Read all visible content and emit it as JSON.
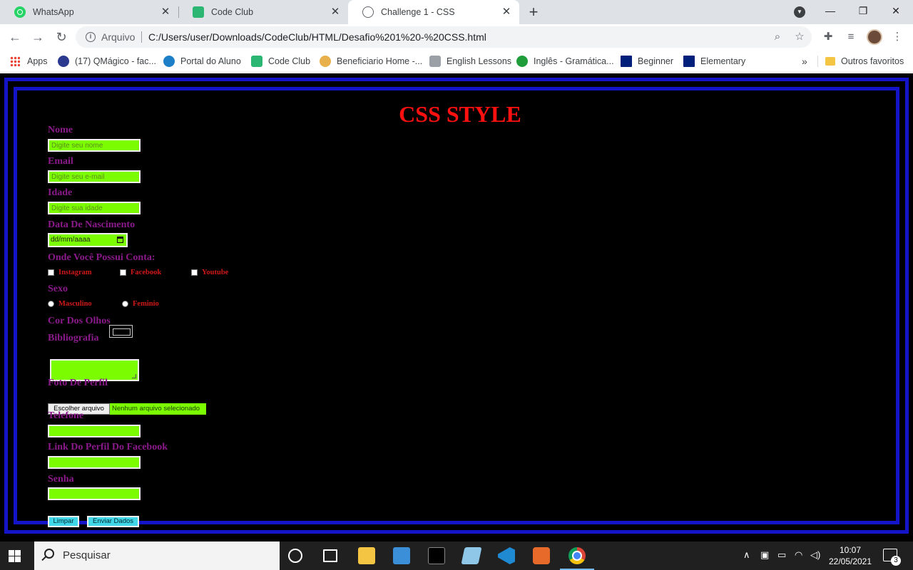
{
  "browser": {
    "tabs": [
      {
        "title": "WhatsApp",
        "icon": "whatsapp-icon"
      },
      {
        "title": "Code Club",
        "icon": "code-club-icon"
      },
      {
        "title": "Challenge 1 - CSS",
        "icon": "globe-icon",
        "active": true
      }
    ],
    "omnibox": {
      "label": "Arquivo",
      "url": "C:/Users/user/Downloads/CodeClub/HTML/Desafio%201%20-%20CSS.html"
    },
    "bookmarks": [
      {
        "label": "Apps",
        "icon": "apps-grid-icon"
      },
      {
        "label": "(17) QMágico - fac...",
        "icon": "qmagico-icon"
      },
      {
        "label": "Portal do Aluno",
        "icon": "portal-icon"
      },
      {
        "label": "Code Club",
        "icon": "code-club-icon"
      },
      {
        "label": "Beneficiario Home -...",
        "icon": "beneficiario-icon"
      },
      {
        "label": "English Lessons",
        "icon": "english-lessons-icon"
      },
      {
        "label": "Inglês - Gramática...",
        "icon": "brazil-flag-icon"
      },
      {
        "label": "Beginner",
        "icon": "oup-icon"
      },
      {
        "label": "Elementary",
        "icon": "oup-icon"
      }
    ],
    "bookmarks_more": "»",
    "other_bookmarks": "Outros favoritos"
  },
  "page": {
    "title": "CSS STYLE",
    "fields": {
      "nome": {
        "label": "Nome",
        "placeholder": "Digite seu nome"
      },
      "email": {
        "label": "Email",
        "placeholder": "Digite seu e-mail"
      },
      "idade": {
        "label": "Idade",
        "placeholder": "Digite sua idade"
      },
      "nascimento": {
        "label": "Data De Nascimento",
        "value": "dd/mm/aaaa"
      },
      "contas": {
        "label": "Onde Você Possui Conta:",
        "options": [
          "Instagram",
          "Facebook",
          "Youtube"
        ]
      },
      "sexo": {
        "label": "Sexo",
        "options": [
          "Masculino",
          "Feminio"
        ]
      },
      "olhos": {
        "label": "Cor Dos Olhos"
      },
      "bibliografia": {
        "label": "Bibliografia"
      },
      "foto": {
        "label": "Foto De Perfil",
        "button": "Escolher arquivo",
        "status": "Nenhum arquivo selecionado"
      },
      "telefone": {
        "label": "Telefone"
      },
      "facebook": {
        "label": "Link Do Perfil Do Facebook"
      },
      "senha": {
        "label": "Senha"
      }
    },
    "buttons": {
      "reset": "Limpar",
      "submit": "Enviar Dados"
    },
    "colors": {
      "background": "#000000",
      "frame": "#1414c8",
      "title": "#ff1010",
      "label": "#8b1a8b",
      "option": "#d01818",
      "input": "#7cfc00",
      "button": "#40d8e8"
    }
  },
  "taskbar": {
    "search_placeholder": "Pesquisar",
    "time": "10:07",
    "date": "22/05/2021",
    "notifications": "3"
  }
}
